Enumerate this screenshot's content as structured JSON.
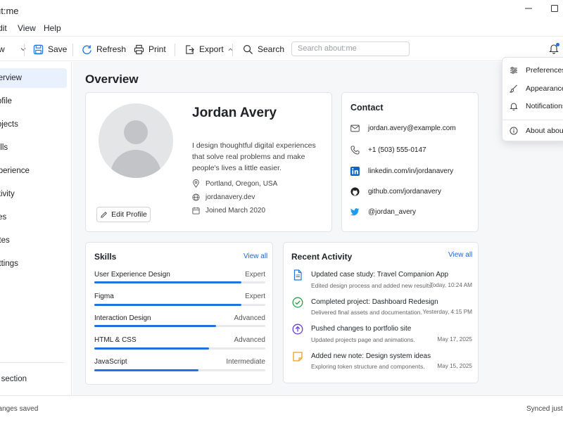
{
  "window": {
    "title": "ut:me"
  },
  "menu": {
    "edit": "dit",
    "view": "View",
    "help": "Help"
  },
  "toolbar": {
    "view_label": "w",
    "save_label": "Save",
    "refresh_label": "Refresh",
    "print_label": "Print",
    "export_label": "Export",
    "search_label": "Search",
    "search_placeholder": "Search about:me"
  },
  "sidebar": {
    "items": [
      {
        "label": "verview",
        "active": true
      },
      {
        "label": "rofile"
      },
      {
        "label": "rojects"
      },
      {
        "label": "kills"
      },
      {
        "label": "xperience"
      },
      {
        "label": "ctivity"
      },
      {
        "label": "iles"
      },
      {
        "label": "otes"
      },
      {
        "label": "ettings"
      }
    ],
    "add_section": "d section"
  },
  "main": {
    "title": "Overview"
  },
  "profile": {
    "name": "Jordan Avery",
    "bio": "I design thoughtful digital experiences that solve real problems and make people's lives a little easier.",
    "location": "Portland, Oregon, USA",
    "website": "jordanavery.dev",
    "joined": "Joined March 2020",
    "edit_button": "Edit Profile"
  },
  "contact": {
    "title": "Contact",
    "email": "jordan.avery@example.com",
    "phone": "+1 (503) 555-0147",
    "linkedin": "linkedin.com/in/jordanavery",
    "github": "github.com/jordanavery",
    "twitter": "@jordan_avery"
  },
  "skills": {
    "title": "Skills",
    "view_all": "View all",
    "items": [
      {
        "name": "User Experience Design",
        "level": "Expert",
        "progress": 0.86
      },
      {
        "name": "Figma",
        "level": "Expert",
        "progress": 0.86
      },
      {
        "name": "Interaction Design",
        "level": "Advanced",
        "progress": 0.71
      },
      {
        "name": "HTML & CSS",
        "level": "Advanced",
        "progress": 0.67
      },
      {
        "name": "JavaScript",
        "level": "Intermediate",
        "progress": 0.61
      }
    ]
  },
  "activity": {
    "title": "Recent Activity",
    "view_all": "View all",
    "items": [
      {
        "icon": "file-icon",
        "title": "Updated case study: Travel Companion App",
        "desc": "Edited design process and added new results.",
        "time": "Today, 10:24 AM"
      },
      {
        "icon": "check-circle-icon",
        "title": "Completed project: Dashboard Redesign",
        "desc": "Delivered final assets and documentation.",
        "time": "Yesterday, 4:15 PM"
      },
      {
        "icon": "upload-circle-icon",
        "title": "Pushed changes to portfolio site",
        "desc": "Updated projects page and animations.",
        "time": "May 17, 2025"
      },
      {
        "icon": "note-icon",
        "title": "Added new note: Design system ideas",
        "desc": "Exploring token structure and components.",
        "time": "May 15, 2025"
      }
    ]
  },
  "dropdown": {
    "preferences": "Preferences",
    "appearance": "Appearance",
    "notifications": "Notifications",
    "about": "About about"
  },
  "status": {
    "left": "hanges saved",
    "right": "Synced just n"
  },
  "colors": {
    "accent": "#1f73e0",
    "green": "#2e9d4a",
    "purple": "#6a3fd0",
    "amber": "#e6a21a"
  }
}
